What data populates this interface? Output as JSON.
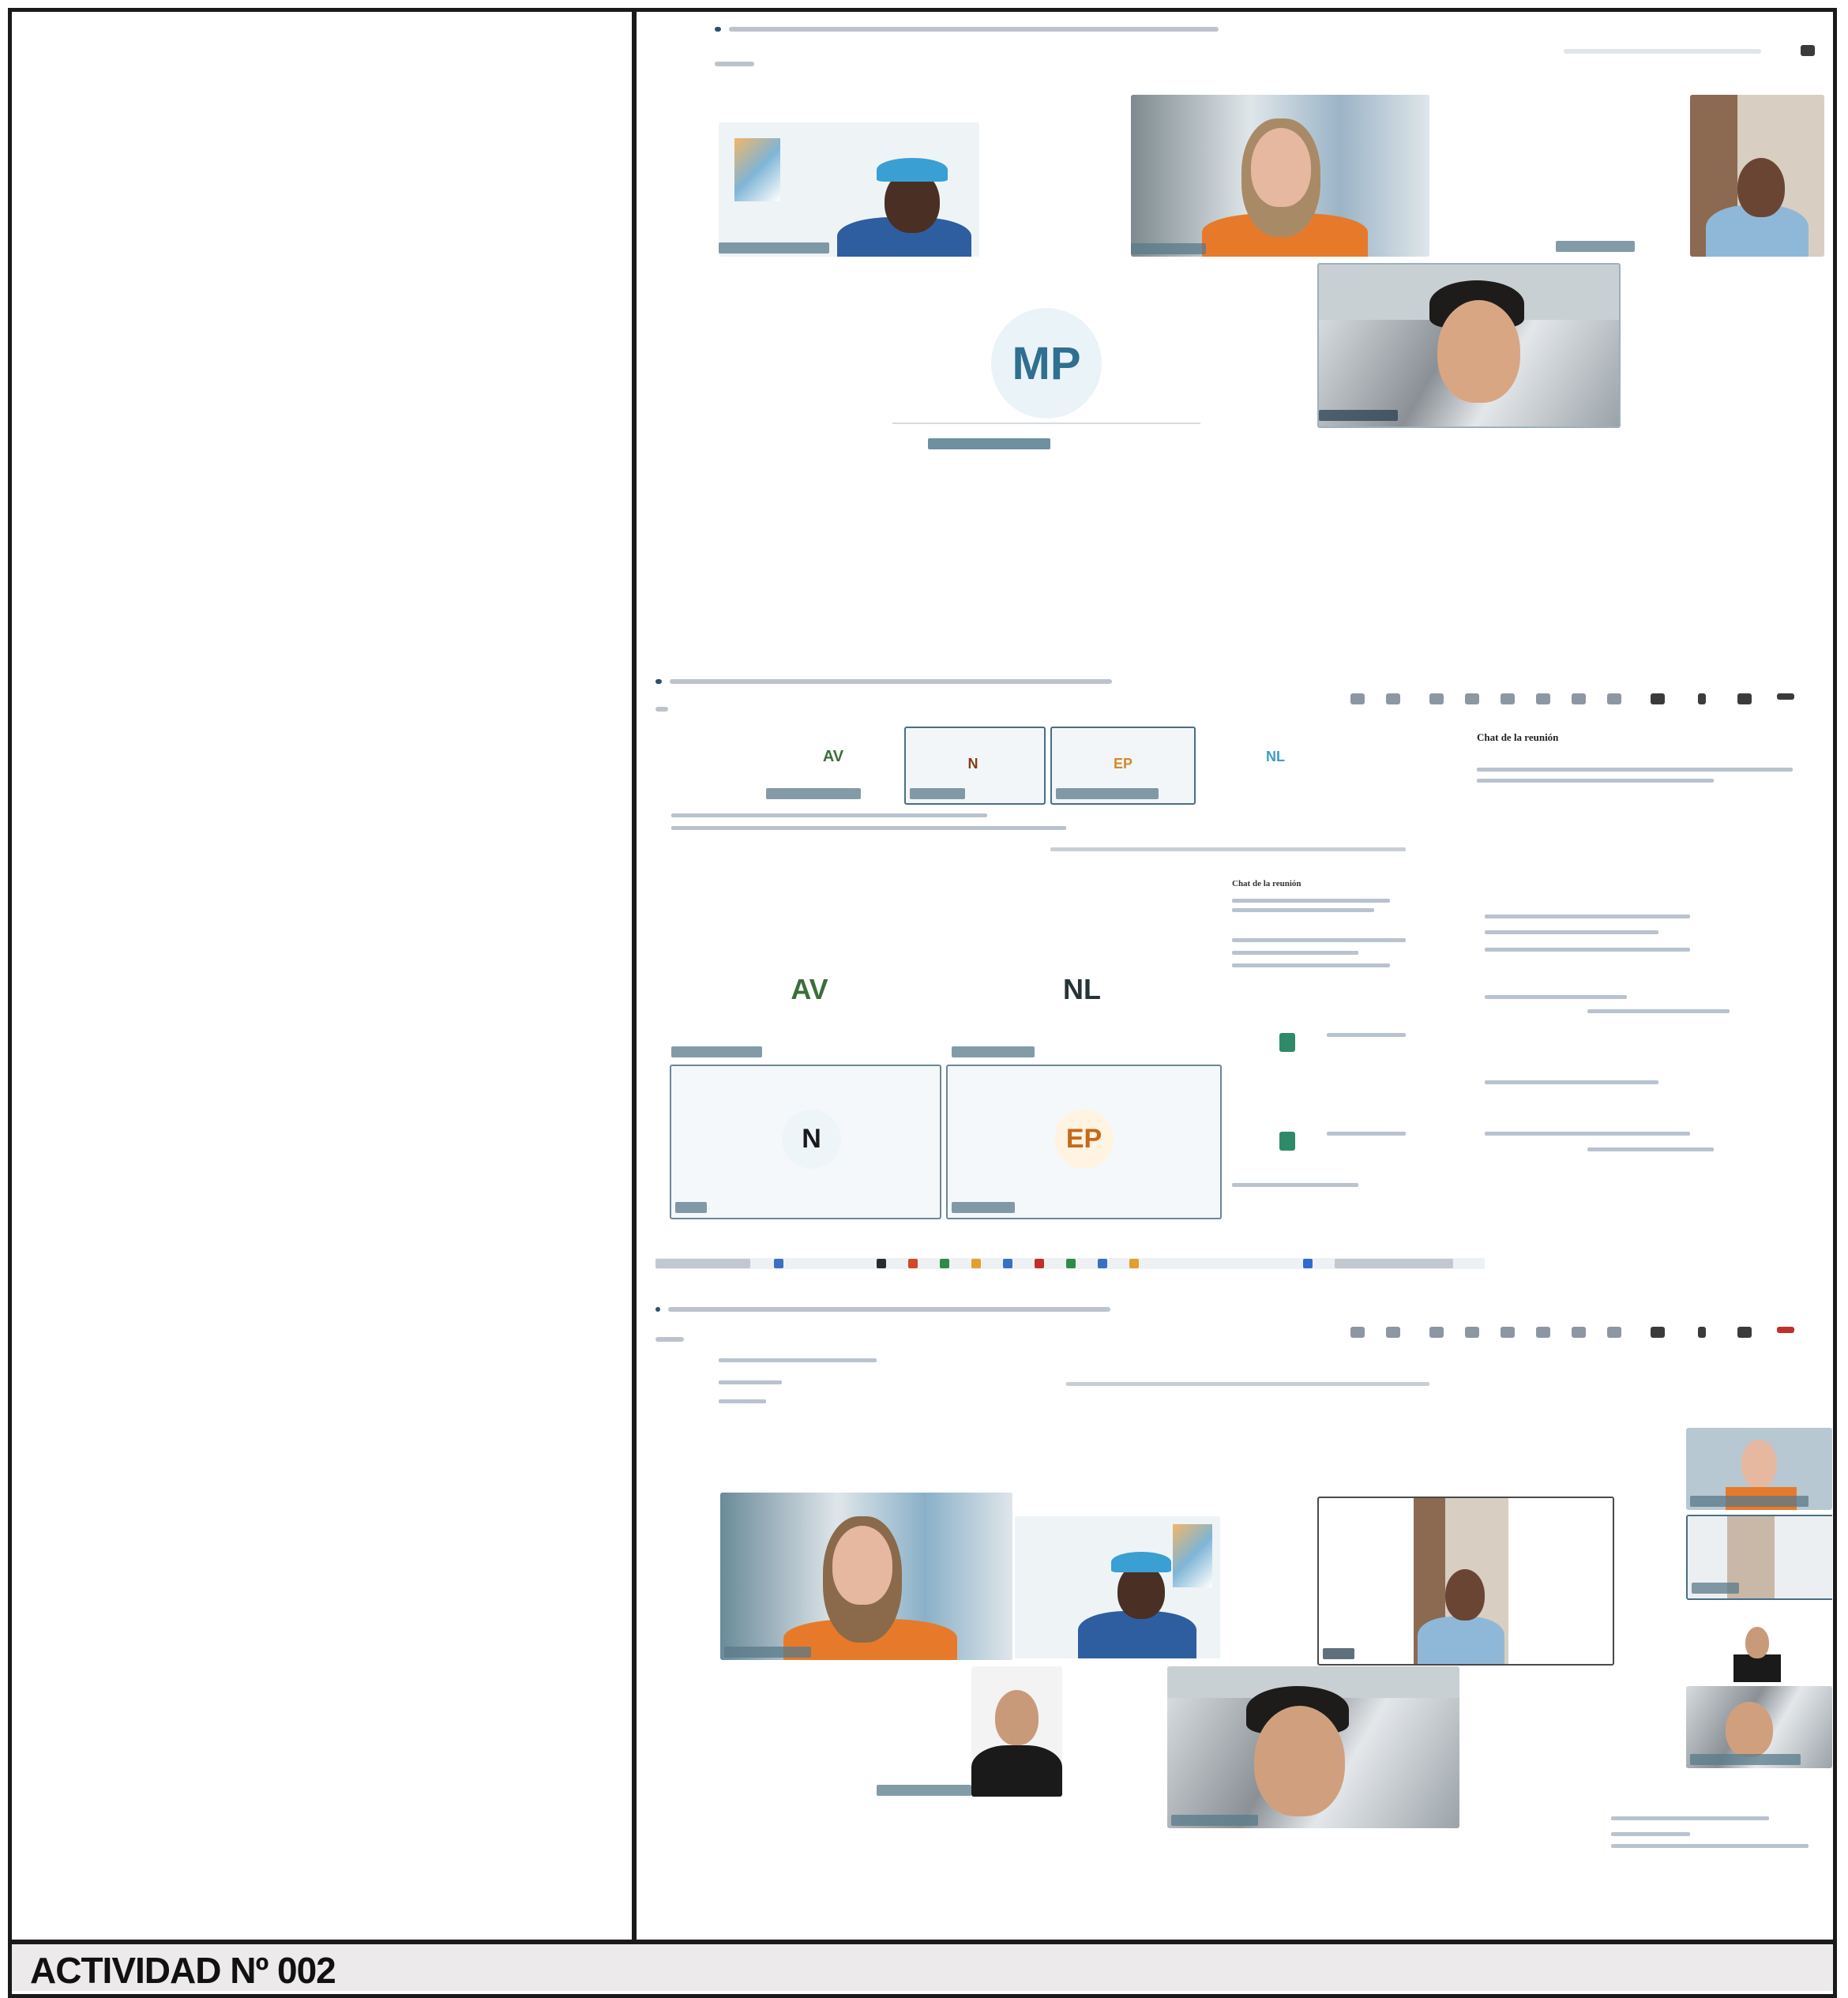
{
  "document": {
    "footer_title": "ACTIVIDAD Nº 002"
  },
  "screenshot1": {
    "tiles": [
      {
        "initials": ""
      },
      {
        "initials": ""
      },
      {
        "initials": "MP"
      }
    ],
    "initials_mp": "MP"
  },
  "screenshot2": {
    "grid_top": [
      "AV",
      "N",
      "EP",
      "NL"
    ],
    "grid_large": [
      "AV",
      "NL",
      "N",
      "EP"
    ],
    "chat_title": "Chat de la reunión"
  },
  "colors": {
    "border": "#1a1a1a",
    "footer_bg": "#eceaea",
    "initials_mp": "#2f6f8f",
    "initials_av": "#3c6e3a",
    "initials_nl": "#27343a",
    "initials_n": "#1a1a1a",
    "initials_ep": "#c46a1a",
    "tag_bg": "#5a7a8a"
  }
}
